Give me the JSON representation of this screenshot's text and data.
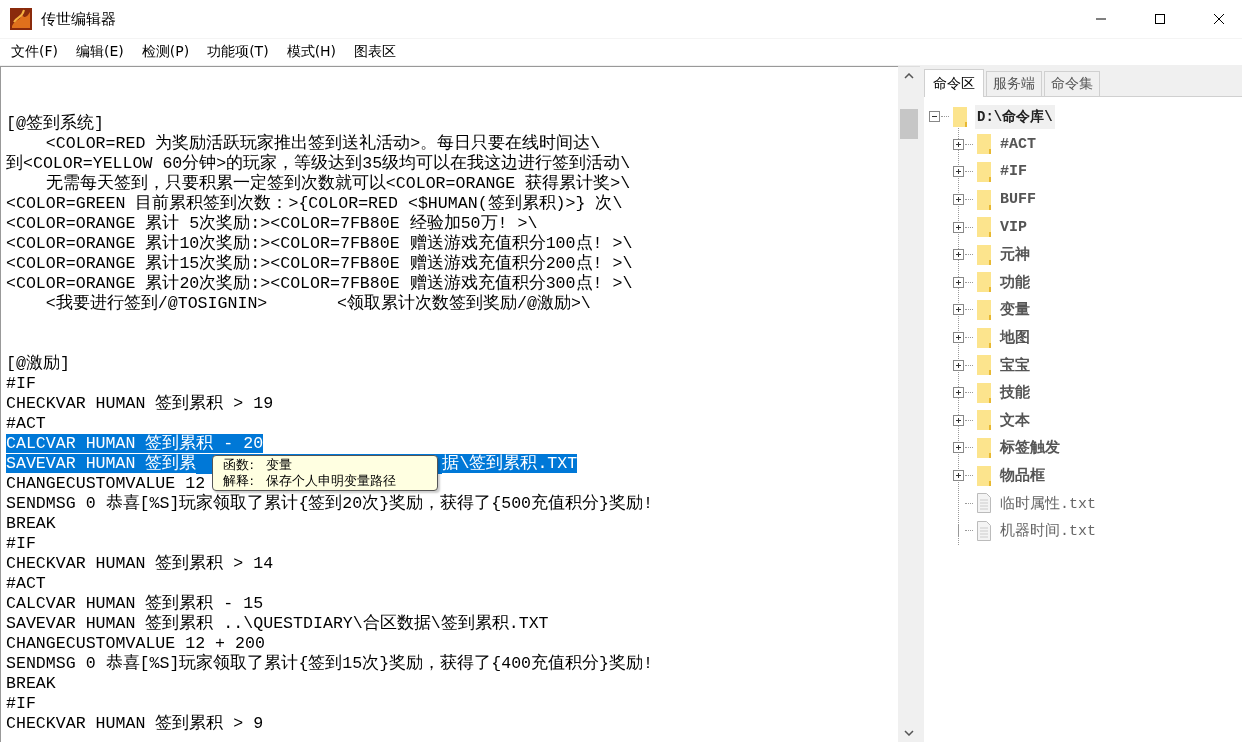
{
  "window": {
    "title": "传世编辑器"
  },
  "menu": [
    "文件(F)",
    "编辑(E)",
    "检测(P)",
    "功能项(T)",
    "模式(H)",
    "图表区"
  ],
  "editor": {
    "lines": [
      {
        "kind": "blank"
      },
      {
        "kind": "blank"
      },
      {
        "kind": "code",
        "text": "[@签到系统]",
        "selected": false
      },
      {
        "kind": "code",
        "text": "    <COLOR=RED 为奖励活跃玩家推出签到送礼活动>。每日只要在线时间达\\",
        "selected": false
      },
      {
        "kind": "code",
        "text": "到<COLOR=YELLOW 60分钟>的玩家，等级达到35级均可以在我这边进行签到活动\\",
        "selected": false
      },
      {
        "kind": "code",
        "text": "    无需每天签到，只要积累一定签到次数就可以<COLOR=ORANGE 获得累计奖>\\",
        "selected": false
      },
      {
        "kind": "code",
        "text": "<COLOR=GREEN 目前累积签到次数：>{COLOR=RED <$HUMAN(签到累积)>} 次\\",
        "selected": false
      },
      {
        "kind": "code",
        "text": "<COLOR=ORANGE 累计 5次奖励:><COLOR=7FB80E 经验加50万! >\\",
        "selected": false
      },
      {
        "kind": "code",
        "text": "<COLOR=ORANGE 累计10次奖励:><COLOR=7FB80E 赠送游戏充值积分100点! >\\",
        "selected": false
      },
      {
        "kind": "code",
        "text": "<COLOR=ORANGE 累计15次奖励:><COLOR=7FB80E 赠送游戏充值积分200点! >\\",
        "selected": false
      },
      {
        "kind": "code",
        "text": "<COLOR=ORANGE 累计20次奖励:><COLOR=7FB80E 赠送游戏充值积分300点! >\\",
        "selected": false
      },
      {
        "kind": "code",
        "text": "    <我要进行签到/@TOSIGNIN>       <领取累计次数签到奖励/@激励>\\",
        "selected": false
      },
      {
        "kind": "blank"
      },
      {
        "kind": "blank"
      },
      {
        "kind": "code",
        "text": "[@激励]",
        "selected": false
      },
      {
        "kind": "code",
        "text": "#IF",
        "selected": false
      },
      {
        "kind": "code",
        "text": "CHECKVAR HUMAN 签到累积 > 19",
        "selected": false
      },
      {
        "kind": "code",
        "text": "#ACT",
        "selected": false
      },
      {
        "kind": "code",
        "text": "CALCVAR HUMAN 签到累积 - 20",
        "selected": true
      },
      {
        "kind": "covered",
        "text": "SAVEVAR HUMAN 签到累",
        "tail": "据\\签到累积.TXT",
        "selected": true,
        "tooltip": {
          "rows": [
            {
              "label": "函数:",
              "value": "变量"
            },
            {
              "label": "解释:",
              "value": "保存个人申明变量路径"
            }
          ]
        }
      },
      {
        "kind": "code",
        "text": "CHANGECUSTOMVALUE 12",
        "selected": false
      },
      {
        "kind": "code",
        "text": "SENDMSG 0 恭喜[%S]玩家领取了累计{签到20次}奖励，获得了{500充值积分}奖励!",
        "selected": false
      },
      {
        "kind": "code",
        "text": "BREAK",
        "selected": false
      },
      {
        "kind": "code",
        "text": "#IF",
        "selected": false
      },
      {
        "kind": "code",
        "text": "CHECKVAR HUMAN 签到累积 > 14",
        "selected": false
      },
      {
        "kind": "code",
        "text": "#ACT",
        "selected": false
      },
      {
        "kind": "code",
        "text": "CALCVAR HUMAN 签到累积 - 15",
        "selected": false
      },
      {
        "kind": "code",
        "text": "SAVEVAR HUMAN 签到累积 ..\\QUESTDIARY\\合区数据\\签到累积.TXT",
        "selected": false
      },
      {
        "kind": "code",
        "text": "CHANGECUSTOMVALUE 12 + 200",
        "selected": false
      },
      {
        "kind": "code",
        "text": "SENDMSG 0 恭喜[%S]玩家领取了累计{签到15次}奖励，获得了{400充值积分}奖励!",
        "selected": false
      },
      {
        "kind": "code",
        "text": "BREAK",
        "selected": false
      },
      {
        "kind": "code",
        "text": "#IF",
        "selected": false
      },
      {
        "kind": "code",
        "text": "CHECKVAR HUMAN 签到累积 > 9",
        "selected": false
      }
    ]
  },
  "side_panel": {
    "tabs": [
      {
        "label": "命令区",
        "selected": true
      },
      {
        "label": "服务端",
        "selected": false
      },
      {
        "label": "命令集",
        "selected": false
      }
    ],
    "tree": {
      "label": "D:\\命令库\\",
      "expanded": true,
      "selected": true,
      "children": [
        {
          "label": "#ACT",
          "kind": "folder",
          "expanded": false,
          "selected": false
        },
        {
          "label": "#IF",
          "kind": "folder",
          "expanded": false,
          "selected": false
        },
        {
          "label": "BUFF",
          "kind": "folder",
          "expanded": false,
          "selected": false
        },
        {
          "label": "VIP",
          "kind": "folder",
          "expanded": false,
          "selected": false
        },
        {
          "label": "元神",
          "kind": "folder",
          "expanded": false,
          "selected": false
        },
        {
          "label": "功能",
          "kind": "folder",
          "expanded": false,
          "selected": false
        },
        {
          "label": "变量",
          "kind": "folder",
          "expanded": false,
          "selected": false
        },
        {
          "label": "地图",
          "kind": "folder",
          "expanded": false,
          "selected": false
        },
        {
          "label": "宝宝",
          "kind": "folder",
          "expanded": false,
          "selected": false
        },
        {
          "label": "技能",
          "kind": "folder",
          "expanded": false,
          "selected": false
        },
        {
          "label": "文本",
          "kind": "folder",
          "expanded": false,
          "selected": false
        },
        {
          "label": "标签触发",
          "kind": "folder",
          "expanded": false,
          "selected": false
        },
        {
          "label": "物品框",
          "kind": "folder",
          "expanded": false,
          "selected": false
        },
        {
          "label": "临时属性.txt",
          "kind": "file",
          "selected": false
        },
        {
          "label": "机器时间.txt",
          "kind": "file",
          "selected": false
        }
      ]
    }
  }
}
